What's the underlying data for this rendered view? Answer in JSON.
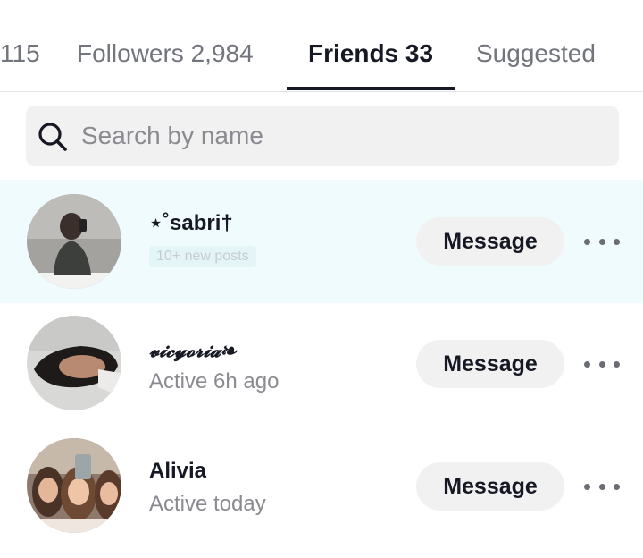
{
  "tabs": [
    {
      "label": "115",
      "active": false
    },
    {
      "label": "Followers 2,984",
      "active": false
    },
    {
      "label": "Friends 33",
      "active": true
    },
    {
      "label": "Suggested",
      "active": false
    }
  ],
  "search": {
    "placeholder": "Search by name",
    "icon": "search-icon"
  },
  "friends": [
    {
      "name": "⋆˚sabri†",
      "badge": "10+ new posts",
      "status": "",
      "button": "Message",
      "more_icon": "more-icon",
      "highlighted": true
    },
    {
      "name": "𝓿𝓲𝓬𝔂𝓸𝓻𝓲𝓪❧",
      "badge": "",
      "status": "Active 6h ago",
      "button": "Message",
      "more_icon": "more-icon",
      "highlighted": false
    },
    {
      "name": "Alivia",
      "badge": "",
      "status": "Active today",
      "button": "Message",
      "more_icon": "more-icon",
      "highlighted": false
    }
  ],
  "colors": {
    "accent": "#161823",
    "highlight_row": "#effbfd",
    "button_bg": "#f1f1f2",
    "muted_text": "#8a8b91"
  }
}
